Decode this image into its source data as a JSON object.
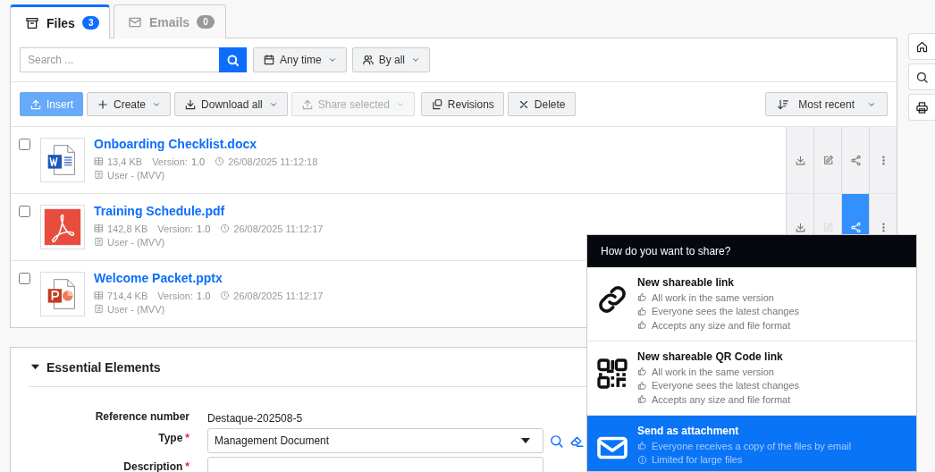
{
  "tabs": [
    {
      "label": "Files",
      "count": "3",
      "kind": "archive",
      "selected": true
    },
    {
      "label": "Emails",
      "count": "0",
      "kind": "mail",
      "selected": false
    }
  ],
  "search": {
    "placeholder": "Search ..."
  },
  "filters": [
    {
      "label": "Any time",
      "kind": "calendar"
    },
    {
      "label": "By all",
      "kind": "users"
    }
  ],
  "toolbar": [
    {
      "label": "Insert",
      "kind": "upload",
      "primary": true,
      "dropdown": false,
      "disabled": false
    },
    {
      "label": "Create",
      "kind": "plus",
      "primary": false,
      "dropdown": true,
      "disabled": false
    },
    {
      "label": "Download all",
      "kind": "download",
      "primary": false,
      "dropdown": true,
      "disabled": false
    },
    {
      "label": "Share selected",
      "kind": "upload",
      "primary": false,
      "dropdown": true,
      "disabled": true
    },
    {
      "label": "Revisions",
      "kind": "revisions",
      "primary": false,
      "dropdown": false,
      "disabled": false
    },
    {
      "label": "Delete",
      "kind": "close",
      "primary": false,
      "dropdown": false,
      "disabled": false
    }
  ],
  "sort": {
    "label": "Most recent"
  },
  "files": [
    {
      "name": "Onboarding Checklist.docx",
      "kind": "word",
      "size": "13,4 KB",
      "version_label": "Version:",
      "version": "1.0",
      "date": "26/08/2025 11:12:18",
      "user": "User - (MVV)",
      "checked": false,
      "actions": [
        {
          "kind": "download",
          "disabled": false,
          "selected": false
        },
        {
          "kind": "edit",
          "disabled": false,
          "selected": false
        },
        {
          "kind": "share",
          "disabled": false,
          "selected": false
        },
        {
          "kind": "more",
          "disabled": false,
          "selected": false
        }
      ]
    },
    {
      "name": "Training Schedule.pdf",
      "kind": "pdf",
      "size": "142,8 KB",
      "version_label": "Version:",
      "version": "1.0",
      "date": "26/08/2025 11:12:17",
      "user": "User - (MVV)",
      "checked": false,
      "actions": [
        {
          "kind": "download",
          "disabled": false,
          "selected": false
        },
        {
          "kind": "edit",
          "disabled": true,
          "selected": false
        },
        {
          "kind": "share",
          "disabled": false,
          "selected": true
        },
        {
          "kind": "more",
          "disabled": false,
          "selected": false
        }
      ]
    },
    {
      "name": "Welcome Packet.pptx",
      "kind": "ppt",
      "size": "714,4 KB",
      "version_label": "Version:",
      "version": "1.0",
      "date": "26/08/2025 11:12:17",
      "user": "User - (MVV)",
      "checked": false
    }
  ],
  "side_buttons": [
    {
      "kind": "home"
    },
    {
      "kind": "search"
    },
    {
      "kind": "print"
    }
  ],
  "section": {
    "title": "Essential Elements",
    "expanded": true,
    "fields": [
      {
        "label": "Reference number",
        "kind": "text",
        "value": "Destaque-202508-5"
      },
      {
        "label": "Type",
        "mark": "*",
        "kind": "select",
        "value": "Management Document"
      },
      {
        "label": "Description",
        "mark": "*",
        "kind": "input"
      }
    ]
  },
  "share_menu": {
    "title": "How do you want to share?",
    "options": [
      {
        "kind": "link",
        "title": "New shareable link",
        "selected": false,
        "points": [
          {
            "kind": "pro",
            "text": "All work in the same version"
          },
          {
            "kind": "pro",
            "text": "Everyone sees the latest changes"
          },
          {
            "kind": "pro",
            "text": "Accepts any size and file format"
          }
        ]
      },
      {
        "kind": "qr",
        "title": "New shareable QR Code link",
        "selected": false,
        "points": [
          {
            "kind": "pro",
            "text": "All work in the same version"
          },
          {
            "kind": "pro",
            "text": "Everyone sees the latest changes"
          },
          {
            "kind": "pro",
            "text": "Accepts any size and file format"
          }
        ]
      },
      {
        "kind": "email",
        "title": "Send as attachment",
        "selected": true,
        "points": [
          {
            "kind": "pro",
            "text": "Everyone receives a copy of the files by email"
          },
          {
            "kind": "limit",
            "text": "Limited for large files"
          }
        ]
      }
    ]
  }
}
